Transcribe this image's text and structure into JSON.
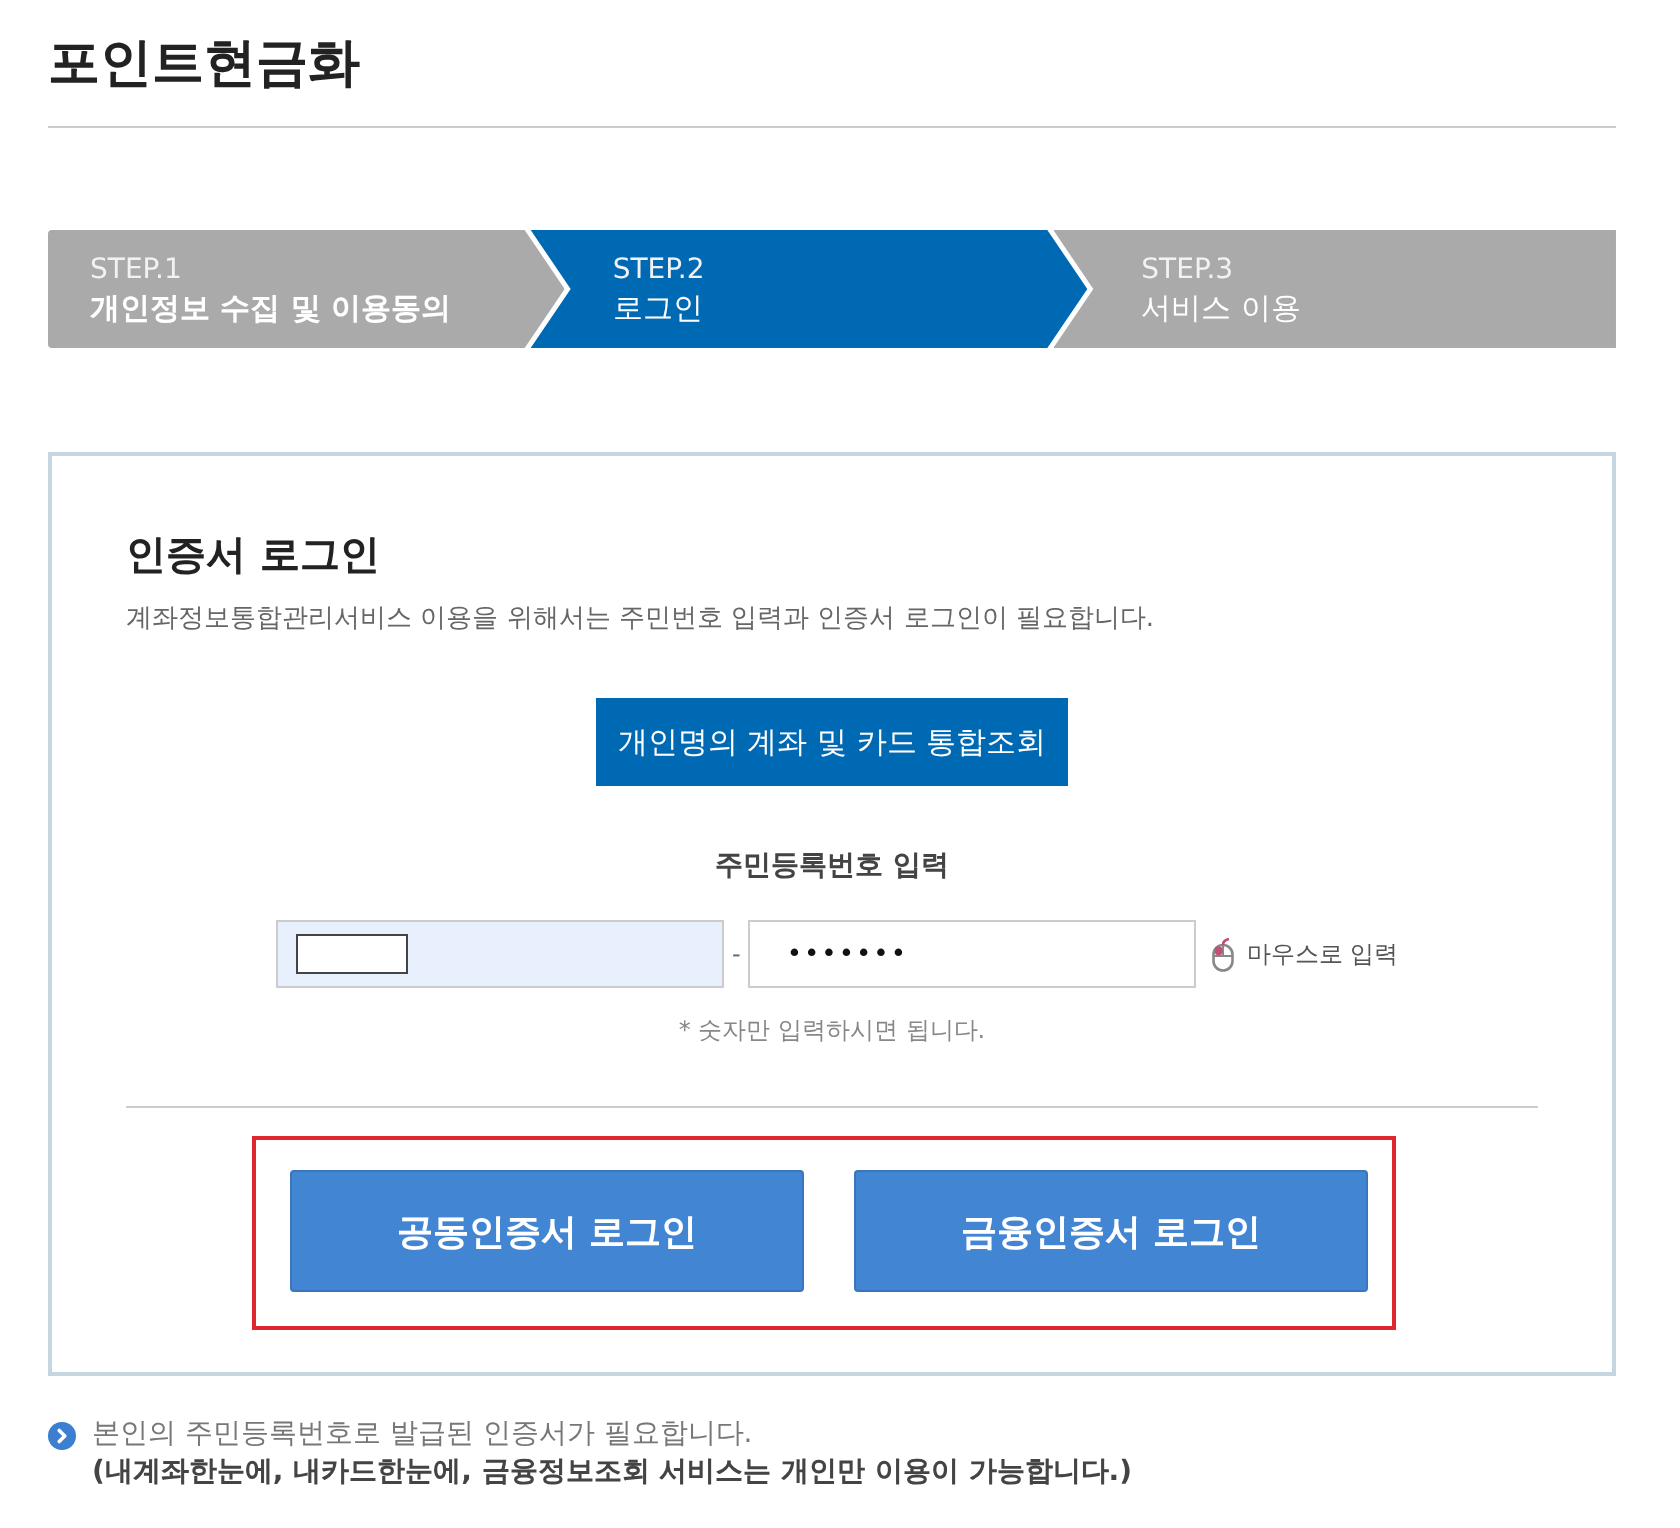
{
  "page": {
    "title": "포인트현금화"
  },
  "steps": [
    {
      "number": "STEP.1",
      "label": "개인정보 수집 및 이용동의",
      "selected": false,
      "completed": true
    },
    {
      "number": "STEP.2",
      "label": "로그인",
      "selected": true,
      "completed": false
    },
    {
      "number": "STEP.3",
      "label": "서비스 이용",
      "selected": false,
      "completed": false
    }
  ],
  "login_panel": {
    "title": "인증서 로그인",
    "description": "계좌정보통합관리서비스 이용을 위해서는 주민번호 입력과 인증서 로그인이 필요합니다.",
    "lookup_button": "개인명의 계좌 및 카드 통합조회",
    "id_number": {
      "label": "주민등록번호 입력",
      "front_field": {
        "highlighted": true
      },
      "separator": "-",
      "back_field": {
        "value": "•••••••"
      },
      "mouse_input": "마우스로 입력",
      "hint": "* 숫자만 입력하시면 됩니다."
    },
    "login_buttons_highlighted": true,
    "login_buttons": [
      {
        "label": "공동인증서 로그인"
      },
      {
        "label": "금융인증서 로그인"
      }
    ]
  },
  "notes": [
    {
      "kind": "plain",
      "text": "본인의 주민등록번호로 발급된 인증서가 필요합니다."
    },
    {
      "kind": "strong",
      "text": "(내계좌한눈에, 내카드한눈에, 금융정보조회 서비스는 개인만 이용이 가능합니다.)"
    }
  ]
}
